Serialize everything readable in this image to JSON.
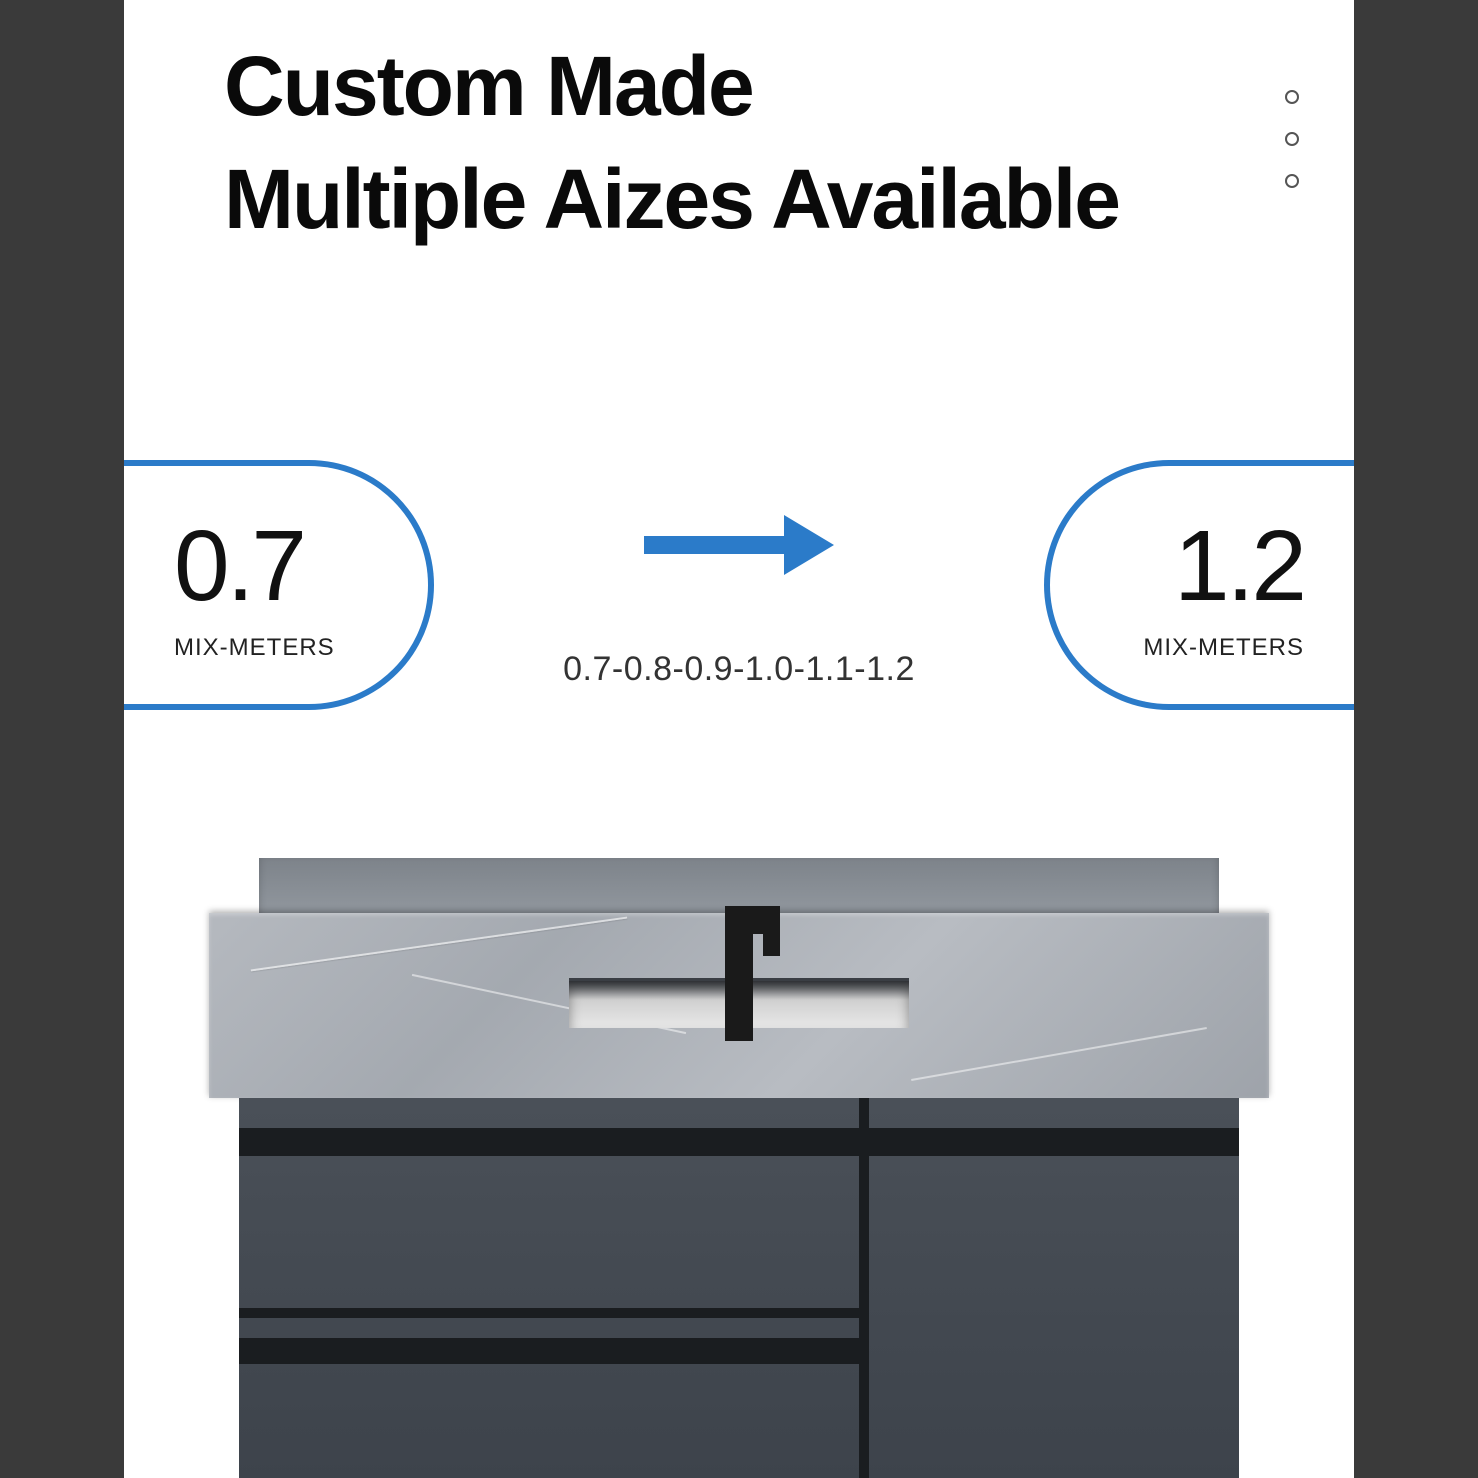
{
  "headline": {
    "line1": "Custom Made",
    "line2": "Multiple Aizes Available"
  },
  "sizes": {
    "min": {
      "value": "0.7",
      "unit": "MIX-METERS"
    },
    "max": {
      "value": "1.2",
      "unit": "MIX-METERS"
    },
    "range": "0.7-0.8-0.9-1.0-1.1-1.2"
  },
  "colors": {
    "accent": "#2b7bc9",
    "cabinet": "#3d434b",
    "counter": "#a4a9b0"
  }
}
